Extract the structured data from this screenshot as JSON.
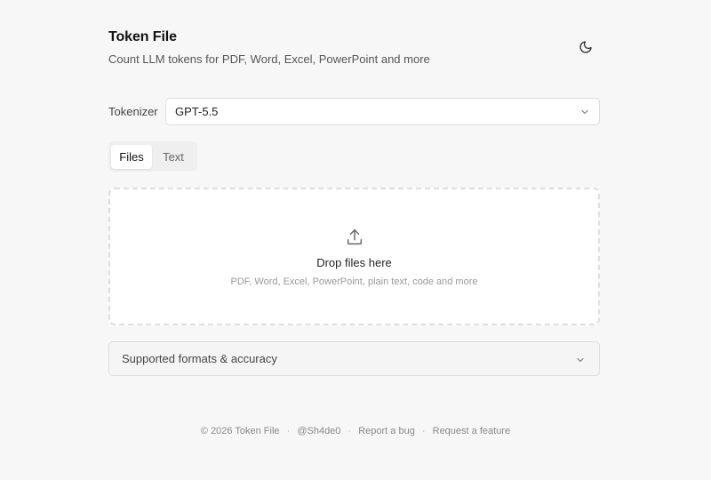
{
  "header": {
    "title": "Token File",
    "subtitle": "Count LLM tokens for PDF, Word, Excel, PowerPoint and more",
    "theme_toggle_icon": "moon-icon"
  },
  "tokenizer": {
    "label": "Tokenizer",
    "selected": "GPT-5.5"
  },
  "tabs": [
    {
      "label": "Files",
      "active": true
    },
    {
      "label": "Text",
      "active": false
    }
  ],
  "dropzone": {
    "icon": "upload-icon",
    "title": "Drop files here",
    "subtitle": "PDF, Word, Excel, PowerPoint, plain text, code and more"
  },
  "accordion": {
    "label": "Supported formats & accuracy"
  },
  "footer": {
    "copyright": "© 2026 Token File",
    "handle": "@Sh4de0",
    "report_bug": "Report a bug",
    "request_feature": "Request a feature",
    "separator": "·"
  },
  "colors": {
    "background": "#f7f7f7",
    "surface": "#ffffff",
    "border": "#dedede",
    "text_primary": "#111111",
    "text_muted": "#888888"
  }
}
